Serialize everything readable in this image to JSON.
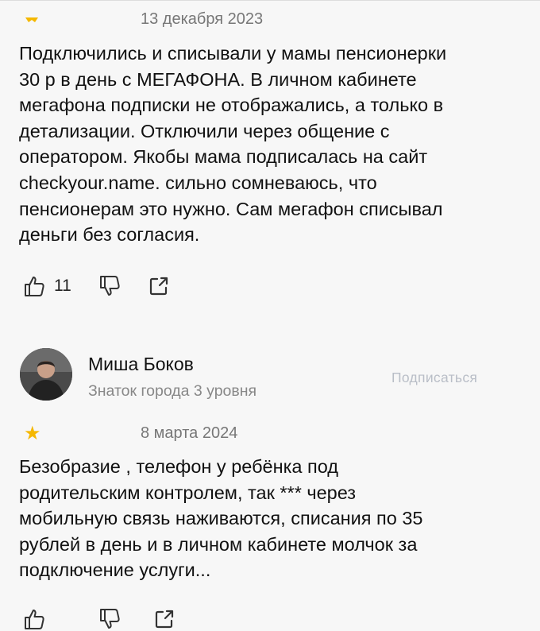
{
  "review1": {
    "date": "13 декабря 2023",
    "lines": [
      "Подключились и списывали у мамы пенсионерки",
      "30 р в день с МЕГАФОНА. В личном кабинете",
      "мегафона подписки не отображались, а только в",
      "детализации. Отключили через общение с",
      "оператором. Якобы мама подписалась на сайт",
      "checkyour.name. сильно сомневаюсь, что",
      "пенсионерам это нужно. Сам мегафон списывал",
      "деньги без согласия."
    ],
    "likes": "11",
    "rating_icon": "star-icon",
    "like_icon": "thumbs-up-icon",
    "dislike_icon": "thumbs-down-icon",
    "share_icon": "share-icon"
  },
  "review2": {
    "author": "Миша Боков",
    "author_level": "Знаток города 3 уровня",
    "subscribe_label": "Подписаться",
    "stars": "★",
    "rating": 1,
    "date": "8 марта 2024",
    "lines": [
      "Безобразие , телефон у ребёнка под",
      "родительским контролем, так *** через",
      "мобильную связь наживаются, списания по 35",
      "рублей в день и в личном кабинете молчок за",
      "подключение услуги..."
    ]
  },
  "colors": {
    "star": "#f5b800",
    "muted": "#777777",
    "subscribe": "#b9bec7"
  }
}
